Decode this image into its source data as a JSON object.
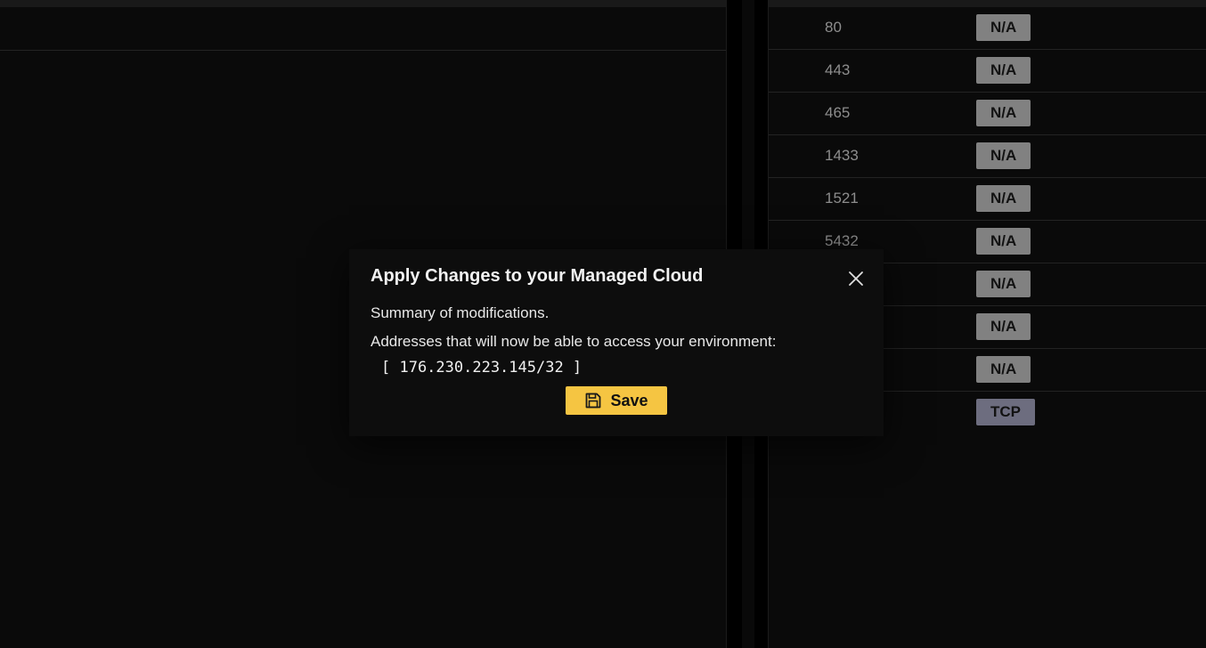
{
  "dialog": {
    "title": "Apply Changes to your Managed Cloud",
    "summary": "Summary of modifications.",
    "addresses_label": "Addresses that will now be able to access your environment:",
    "addresses_display": "[ 176.230.223.145/32 ]",
    "save_label": "Save",
    "close_icon": "close-icon",
    "save_icon": "floppy-disk-icon",
    "save_button_color": "#f5c542"
  },
  "ports_table": {
    "rows": [
      {
        "port": "80",
        "protocol": "N/A"
      },
      {
        "port": "443",
        "protocol": "N/A"
      },
      {
        "port": "465",
        "protocol": "N/A"
      },
      {
        "port": "1433",
        "protocol": "N/A"
      },
      {
        "port": "1521",
        "protocol": "N/A"
      },
      {
        "port": "5432",
        "protocol": "N/A"
      },
      {
        "port": "",
        "protocol": "N/A"
      },
      {
        "port": "",
        "protocol": "N/A"
      },
      {
        "port": "",
        "protocol": "N/A"
      },
      {
        "port": "",
        "protocol": "TCP"
      }
    ]
  },
  "colors": {
    "background": "#0b0b0b",
    "badge_na": "#8c8c8c",
    "badge_tcp": "#77778a"
  }
}
